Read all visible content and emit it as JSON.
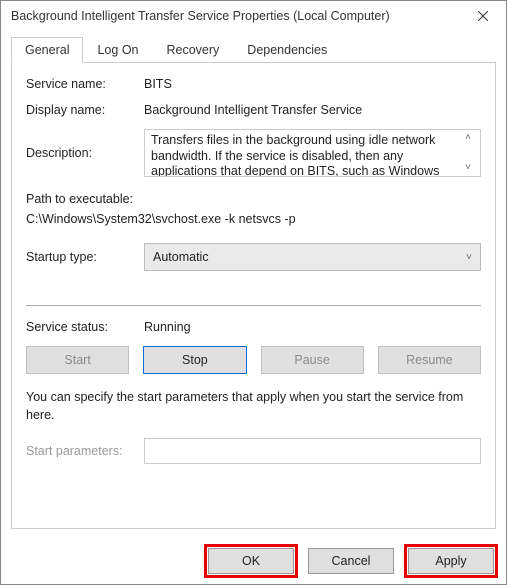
{
  "titlebar": {
    "title": "Background Intelligent Transfer Service Properties (Local Computer)"
  },
  "tabs": {
    "general": "General",
    "logon": "Log On",
    "recovery": "Recovery",
    "dependencies": "Dependencies"
  },
  "labels": {
    "service_name": "Service name:",
    "display_name": "Display name:",
    "description": "Description:",
    "path_to_exe": "Path to executable:",
    "startup_type": "Startup type:",
    "service_status": "Service status:",
    "start_parameters": "Start parameters:"
  },
  "values": {
    "service_name": "BITS",
    "display_name": "Background Intelligent Transfer Service",
    "description": "Transfers files in the background using idle network bandwidth. If the service is disabled, then any applications that depend on BITS, such as Windows",
    "path": "C:\\Windows\\System32\\svchost.exe -k netsvcs -p",
    "startup_type": "Automatic",
    "service_status": "Running"
  },
  "buttons": {
    "start": "Start",
    "stop": "Stop",
    "pause": "Pause",
    "resume": "Resume",
    "ok": "OK",
    "cancel": "Cancel",
    "apply": "Apply"
  },
  "help": "You can specify the start parameters that apply when you start the service from here."
}
